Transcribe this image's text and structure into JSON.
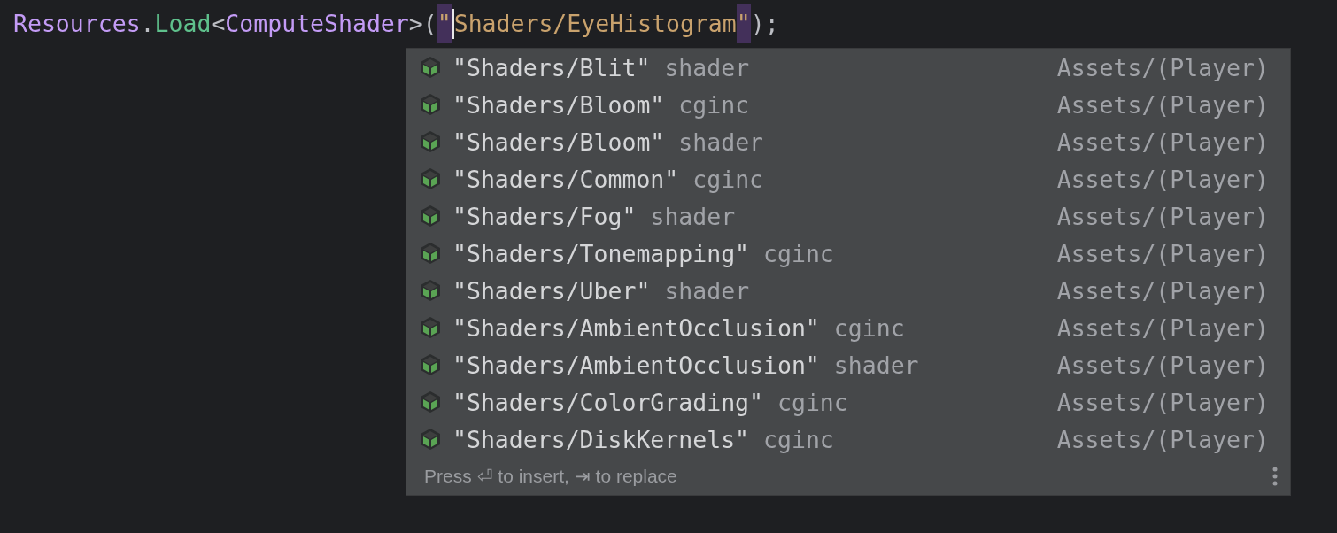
{
  "code_line": [
    {
      "kind": "type",
      "text": "Resources"
    },
    {
      "kind": "punct",
      "text": "."
    },
    {
      "kind": "method",
      "text": "Load"
    },
    {
      "kind": "punct",
      "text": "<"
    },
    {
      "kind": "type",
      "text": "ComputeShader"
    },
    {
      "kind": "punct",
      "text": ">("
    },
    {
      "kind": "quote",
      "text": "\""
    },
    {
      "kind": "caret"
    },
    {
      "kind": "string",
      "text": "Shaders/EyeHistogram"
    },
    {
      "kind": "quote",
      "text": "\""
    },
    {
      "kind": "punct",
      "text": ");"
    }
  ],
  "completion": {
    "items": [
      {
        "name": "\"Shaders/Blit\"",
        "type": "shader",
        "location": "Assets/(Player)"
      },
      {
        "name": "\"Shaders/Bloom\"",
        "type": "cginc",
        "location": "Assets/(Player)"
      },
      {
        "name": "\"Shaders/Bloom\"",
        "type": "shader",
        "location": "Assets/(Player)"
      },
      {
        "name": "\"Shaders/Common\"",
        "type": "cginc",
        "location": "Assets/(Player)"
      },
      {
        "name": "\"Shaders/Fog\"",
        "type": "shader",
        "location": "Assets/(Player)"
      },
      {
        "name": "\"Shaders/Tonemapping\"",
        "type": "cginc",
        "location": "Assets/(Player)"
      },
      {
        "name": "\"Shaders/Uber\"",
        "type": "shader",
        "location": "Assets/(Player)"
      },
      {
        "name": "\"Shaders/AmbientOcclusion\"",
        "type": "cginc",
        "location": "Assets/(Player)"
      },
      {
        "name": "\"Shaders/AmbientOcclusion\"",
        "type": "shader",
        "location": "Assets/(Player)"
      },
      {
        "name": "\"Shaders/ColorGrading\"",
        "type": "cginc",
        "location": "Assets/(Player)"
      },
      {
        "name": "\"Shaders/DiskKernels\"",
        "type": "cginc",
        "location": "Assets/(Player)"
      }
    ],
    "footer": "Press ⏎ to insert, ⇥ to replace"
  }
}
